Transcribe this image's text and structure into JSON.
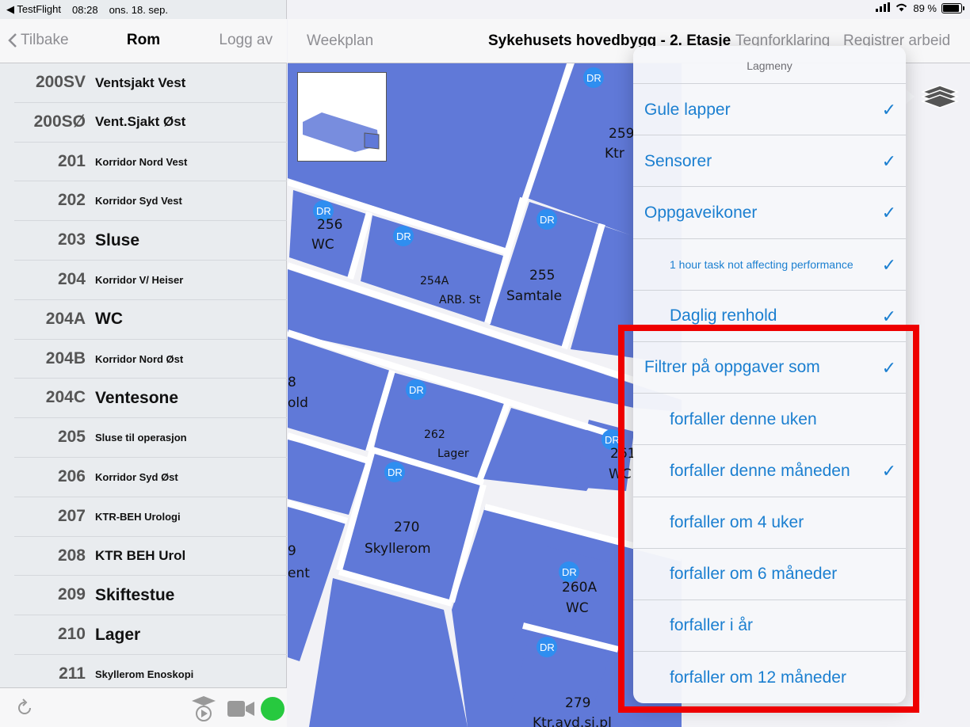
{
  "status": {
    "app_back": "◀ TestFlight",
    "time": "08:28",
    "date": "ons. 18. sep.",
    "battery_text": "89 %"
  },
  "sidebar": {
    "back_label": "Tilbake",
    "title": "Rom",
    "right_label": "Logg av",
    "rooms": [
      {
        "num": "200SV",
        "name": "Ventsjakt Vest",
        "size": "md"
      },
      {
        "num": "200SØ",
        "name": "Vent.Sjakt Øst",
        "size": "md"
      },
      {
        "num": "201",
        "name": "Korridor Nord Vest",
        "size": "sm"
      },
      {
        "num": "202",
        "name": "Korridor Syd Vest",
        "size": "sm"
      },
      {
        "num": "203",
        "name": "Sluse",
        "size": "lg"
      },
      {
        "num": "204",
        "name": "Korridor V/ Heiser",
        "size": "sm"
      },
      {
        "num": "204A",
        "name": "WC",
        "size": "lg"
      },
      {
        "num": "204B",
        "name": "Korridor Nord Øst",
        "size": "sm"
      },
      {
        "num": "204C",
        "name": "Ventesone",
        "size": "lg"
      },
      {
        "num": "205",
        "name": "Sluse til operasjon",
        "size": "sm"
      },
      {
        "num": "206",
        "name": "Korridor Syd Øst",
        "size": "sm"
      },
      {
        "num": "207",
        "name": "KTR-BEH Urologi",
        "size": "sm"
      },
      {
        "num": "208",
        "name": "KTR BEH Urol",
        "size": "md"
      },
      {
        "num": "209",
        "name": "Skiftestue",
        "size": "lg"
      },
      {
        "num": "210",
        "name": "Lager",
        "size": "lg"
      },
      {
        "num": "211",
        "name": "Skyllerom Enoskopi",
        "size": "sm"
      }
    ]
  },
  "main_nav": {
    "left": "Weekplan",
    "title": "Sykehusets hovedbygg - 2. Etasje",
    "right1": "Tegnforklaring",
    "right2": "Registrer arbeid"
  },
  "map": {
    "dr": "DR",
    "labels": {
      "r259a": "259",
      "r259b": "Ktr",
      "r256a": "256",
      "r256b": "WC",
      "r254a": "254A",
      "r254b": "ARB. St",
      "r255a": "255",
      "r255b": "Samtale",
      "r262a": "262",
      "r262b": "Lager",
      "r261a": "261",
      "r261b": "WC",
      "r270a": "270",
      "r270b": "Skyllerom",
      "r260a": "260A",
      "r260b": "WC",
      "r279a": "279",
      "r279b": "Ktr.avd.sj.pl",
      "r8a": "8",
      "r8b": "old",
      "r9a": "9",
      "r9b": "ent"
    }
  },
  "layer_menu": {
    "title": "Lagmeny",
    "items": [
      {
        "label": "Gule lapper",
        "checked": "✓",
        "indent": "l0"
      },
      {
        "label": "Sensorer",
        "checked": "✓",
        "indent": "l0"
      },
      {
        "label": "Oppgaveikoner",
        "checked": "✓",
        "indent": "l0"
      },
      {
        "label": "1 hour task not affecting performance",
        "checked": "✓",
        "indent": "l1s"
      },
      {
        "label": "Daglig renhold",
        "checked": "✓",
        "indent": "l1"
      },
      {
        "label": "Filtrer på oppgaver som",
        "checked": "✓",
        "indent": "l0"
      },
      {
        "label": "forfaller denne uken",
        "checked": "",
        "indent": "l1"
      },
      {
        "label": "forfaller denne måneden",
        "checked": "✓",
        "indent": "l1"
      },
      {
        "label": "forfaller om 4 uker",
        "checked": "",
        "indent": "l1"
      },
      {
        "label": "forfaller om 6 måneder",
        "checked": "",
        "indent": "l1"
      },
      {
        "label": "forfaller i år",
        "checked": "",
        "indent": "l1"
      },
      {
        "label": "forfaller om 12 måneder",
        "checked": "",
        "indent": "l1"
      }
    ]
  },
  "colors": {
    "room_fill": "#6079d8",
    "dr_badge": "#2f8ef0",
    "accent": "#1b7fd0",
    "highlight": "#ee0000",
    "record_dot": "#27c93f"
  }
}
